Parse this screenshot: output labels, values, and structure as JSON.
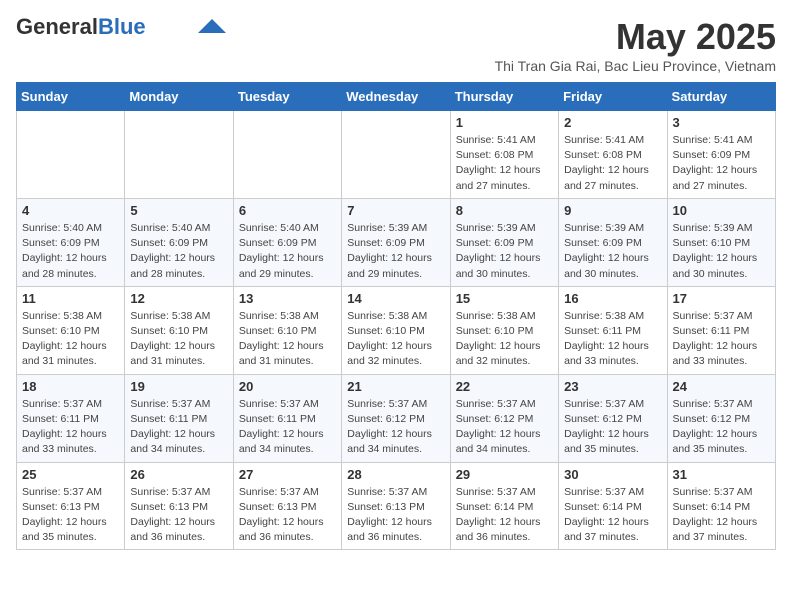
{
  "header": {
    "logo_general": "General",
    "logo_blue": "Blue",
    "month_title": "May 2025",
    "subtitle": "Thi Tran Gia Rai, Bac Lieu Province, Vietnam"
  },
  "weekdays": [
    "Sunday",
    "Monday",
    "Tuesday",
    "Wednesday",
    "Thursday",
    "Friday",
    "Saturday"
  ],
  "weeks": [
    [
      {
        "day": "",
        "info": ""
      },
      {
        "day": "",
        "info": ""
      },
      {
        "day": "",
        "info": ""
      },
      {
        "day": "",
        "info": ""
      },
      {
        "day": "1",
        "info": "Sunrise: 5:41 AM\nSunset: 6:08 PM\nDaylight: 12 hours and 27 minutes."
      },
      {
        "day": "2",
        "info": "Sunrise: 5:41 AM\nSunset: 6:08 PM\nDaylight: 12 hours and 27 minutes."
      },
      {
        "day": "3",
        "info": "Sunrise: 5:41 AM\nSunset: 6:09 PM\nDaylight: 12 hours and 27 minutes."
      }
    ],
    [
      {
        "day": "4",
        "info": "Sunrise: 5:40 AM\nSunset: 6:09 PM\nDaylight: 12 hours and 28 minutes."
      },
      {
        "day": "5",
        "info": "Sunrise: 5:40 AM\nSunset: 6:09 PM\nDaylight: 12 hours and 28 minutes."
      },
      {
        "day": "6",
        "info": "Sunrise: 5:40 AM\nSunset: 6:09 PM\nDaylight: 12 hours and 29 minutes."
      },
      {
        "day": "7",
        "info": "Sunrise: 5:39 AM\nSunset: 6:09 PM\nDaylight: 12 hours and 29 minutes."
      },
      {
        "day": "8",
        "info": "Sunrise: 5:39 AM\nSunset: 6:09 PM\nDaylight: 12 hours and 30 minutes."
      },
      {
        "day": "9",
        "info": "Sunrise: 5:39 AM\nSunset: 6:09 PM\nDaylight: 12 hours and 30 minutes."
      },
      {
        "day": "10",
        "info": "Sunrise: 5:39 AM\nSunset: 6:10 PM\nDaylight: 12 hours and 30 minutes."
      }
    ],
    [
      {
        "day": "11",
        "info": "Sunrise: 5:38 AM\nSunset: 6:10 PM\nDaylight: 12 hours and 31 minutes."
      },
      {
        "day": "12",
        "info": "Sunrise: 5:38 AM\nSunset: 6:10 PM\nDaylight: 12 hours and 31 minutes."
      },
      {
        "day": "13",
        "info": "Sunrise: 5:38 AM\nSunset: 6:10 PM\nDaylight: 12 hours and 31 minutes."
      },
      {
        "day": "14",
        "info": "Sunrise: 5:38 AM\nSunset: 6:10 PM\nDaylight: 12 hours and 32 minutes."
      },
      {
        "day": "15",
        "info": "Sunrise: 5:38 AM\nSunset: 6:10 PM\nDaylight: 12 hours and 32 minutes."
      },
      {
        "day": "16",
        "info": "Sunrise: 5:38 AM\nSunset: 6:11 PM\nDaylight: 12 hours and 33 minutes."
      },
      {
        "day": "17",
        "info": "Sunrise: 5:37 AM\nSunset: 6:11 PM\nDaylight: 12 hours and 33 minutes."
      }
    ],
    [
      {
        "day": "18",
        "info": "Sunrise: 5:37 AM\nSunset: 6:11 PM\nDaylight: 12 hours and 33 minutes."
      },
      {
        "day": "19",
        "info": "Sunrise: 5:37 AM\nSunset: 6:11 PM\nDaylight: 12 hours and 34 minutes."
      },
      {
        "day": "20",
        "info": "Sunrise: 5:37 AM\nSunset: 6:11 PM\nDaylight: 12 hours and 34 minutes."
      },
      {
        "day": "21",
        "info": "Sunrise: 5:37 AM\nSunset: 6:12 PM\nDaylight: 12 hours and 34 minutes."
      },
      {
        "day": "22",
        "info": "Sunrise: 5:37 AM\nSunset: 6:12 PM\nDaylight: 12 hours and 34 minutes."
      },
      {
        "day": "23",
        "info": "Sunrise: 5:37 AM\nSunset: 6:12 PM\nDaylight: 12 hours and 35 minutes."
      },
      {
        "day": "24",
        "info": "Sunrise: 5:37 AM\nSunset: 6:12 PM\nDaylight: 12 hours and 35 minutes."
      }
    ],
    [
      {
        "day": "25",
        "info": "Sunrise: 5:37 AM\nSunset: 6:13 PM\nDaylight: 12 hours and 35 minutes."
      },
      {
        "day": "26",
        "info": "Sunrise: 5:37 AM\nSunset: 6:13 PM\nDaylight: 12 hours and 36 minutes."
      },
      {
        "day": "27",
        "info": "Sunrise: 5:37 AM\nSunset: 6:13 PM\nDaylight: 12 hours and 36 minutes."
      },
      {
        "day": "28",
        "info": "Sunrise: 5:37 AM\nSunset: 6:13 PM\nDaylight: 12 hours and 36 minutes."
      },
      {
        "day": "29",
        "info": "Sunrise: 5:37 AM\nSunset: 6:14 PM\nDaylight: 12 hours and 36 minutes."
      },
      {
        "day": "30",
        "info": "Sunrise: 5:37 AM\nSunset: 6:14 PM\nDaylight: 12 hours and 37 minutes."
      },
      {
        "day": "31",
        "info": "Sunrise: 5:37 AM\nSunset: 6:14 PM\nDaylight: 12 hours and 37 minutes."
      }
    ]
  ]
}
